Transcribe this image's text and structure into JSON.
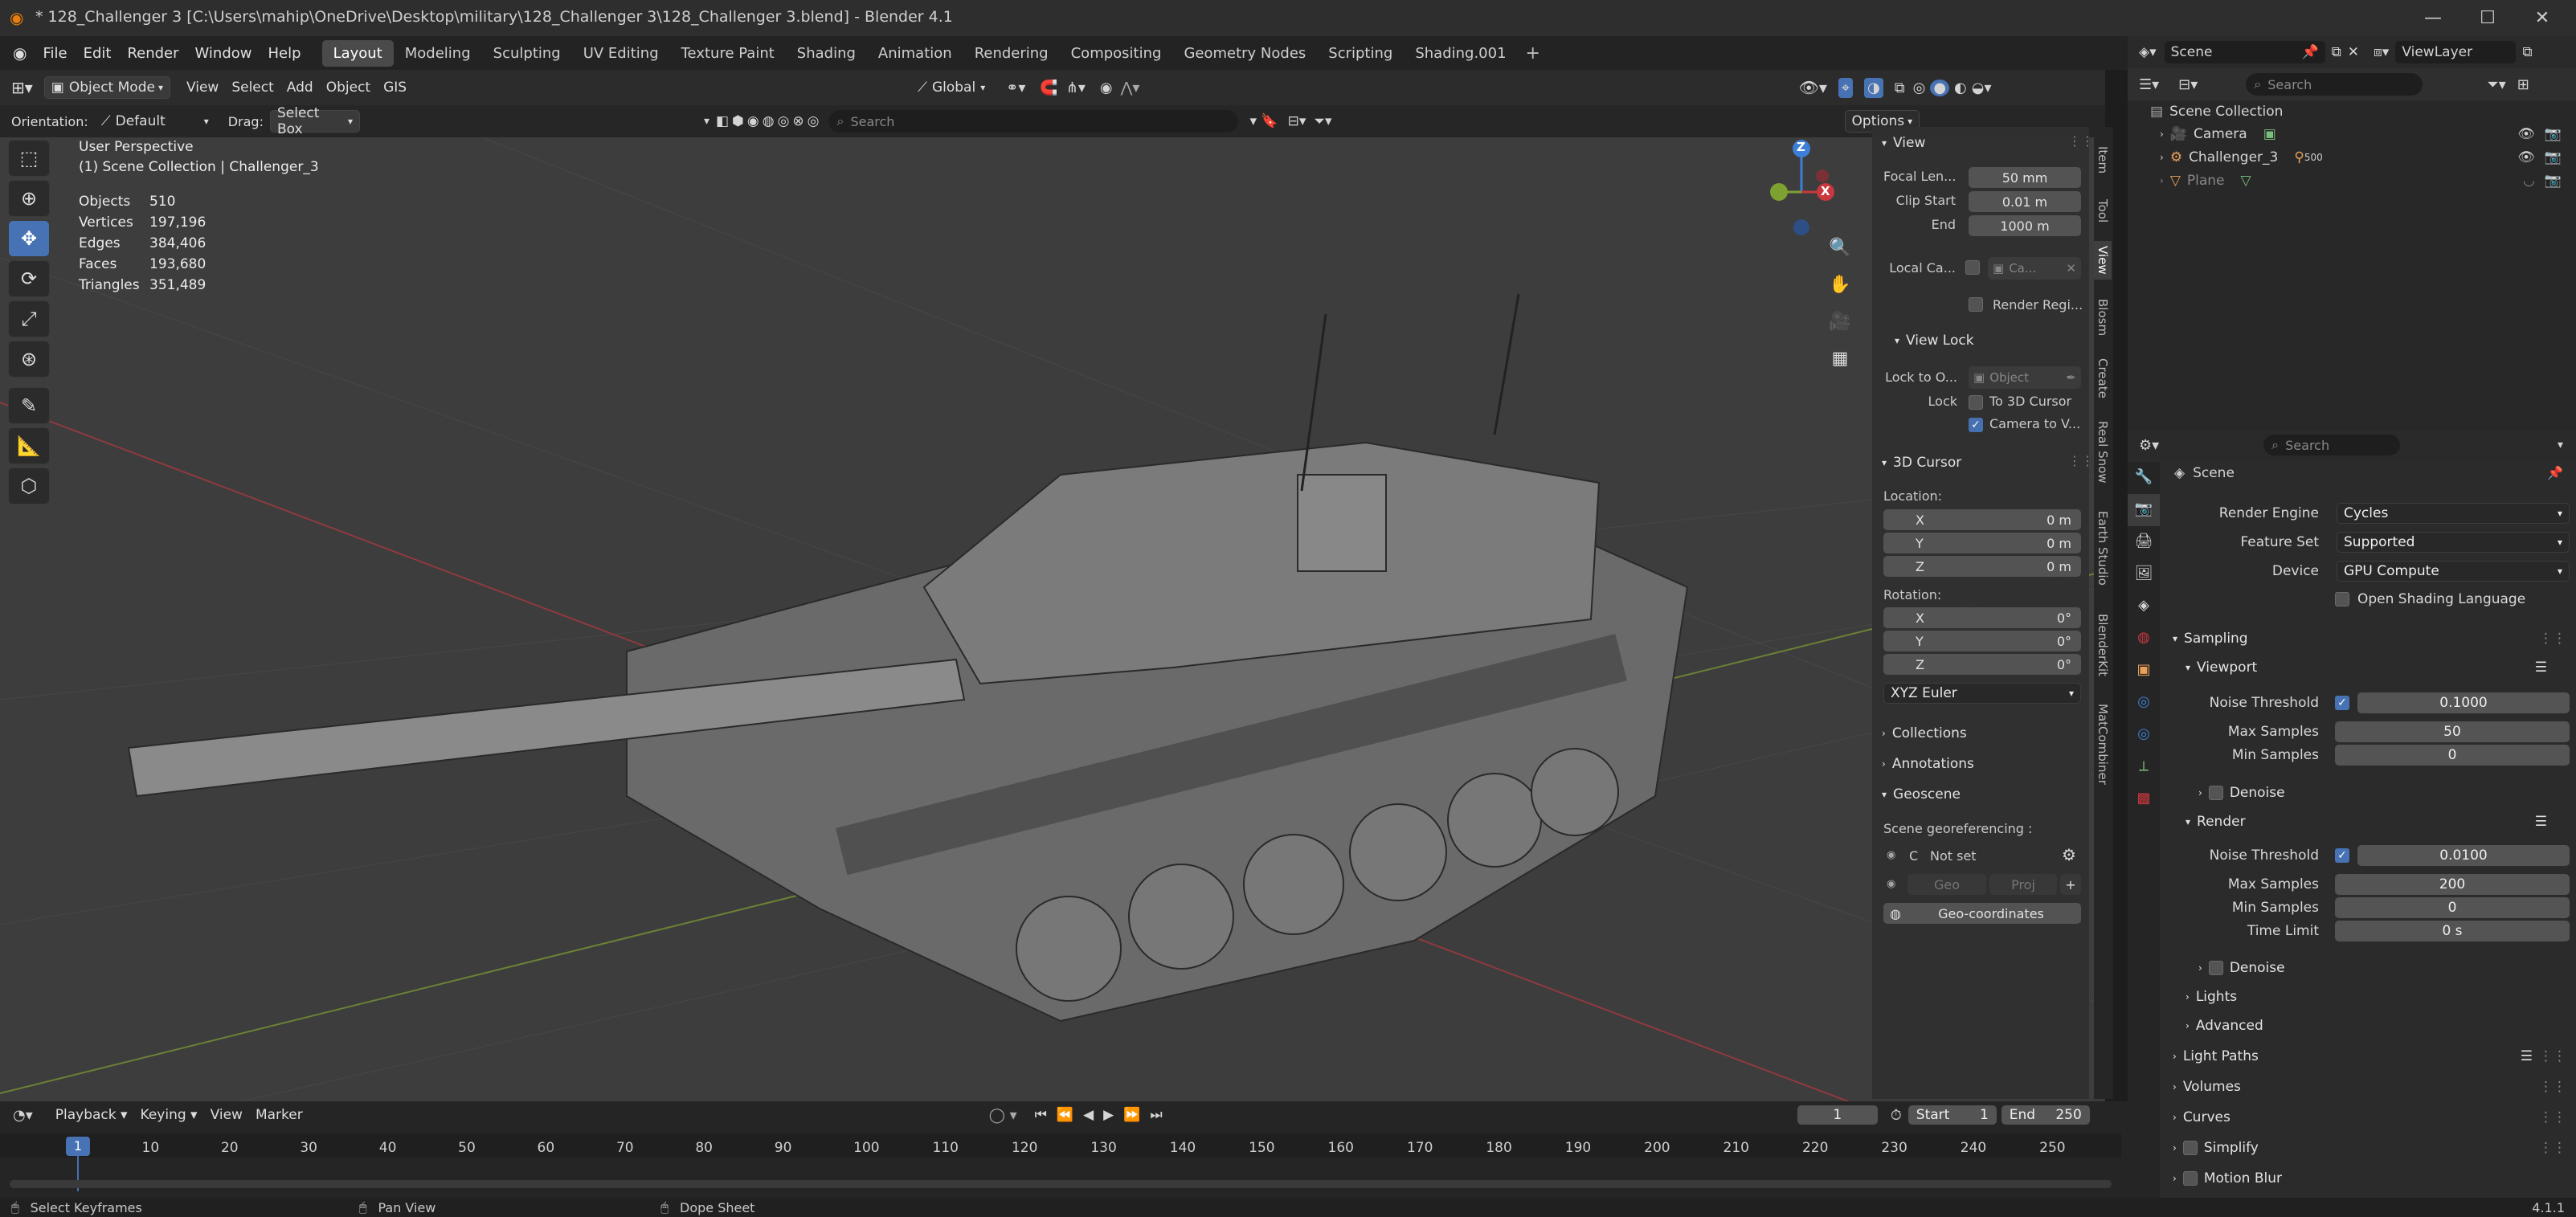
{
  "window": {
    "title": "* 128_Challenger 3 [C:\\Users\\mahip\\OneDrive\\Desktop\\military\\128_Challenger 3\\128_Challenger 3.blend] - Blender 4.1"
  },
  "menu": [
    "File",
    "Edit",
    "Render",
    "Window",
    "Help"
  ],
  "workspaces": [
    "Layout",
    "Modeling",
    "Sculpting",
    "UV Editing",
    "Texture Paint",
    "Shading",
    "Animation",
    "Rendering",
    "Compositing",
    "Geometry Nodes",
    "Scripting",
    "Shading.001"
  ],
  "scene_selector": {
    "scene": "Scene",
    "view_layer": "ViewLayer"
  },
  "header": {
    "mode": "Object Mode",
    "menus": [
      "View",
      "Select",
      "Add",
      "Object",
      "GIS"
    ],
    "transform_orientation": "Global",
    "orientation_label": "Orientation:",
    "orientation_value": "Default",
    "drag_label": "Drag:",
    "drag_value": "Select Box",
    "search_placeholder": "Search",
    "options_label": "Options"
  },
  "viewport": {
    "perspective": "User Perspective",
    "collection": "(1) Scene Collection | Challenger_3",
    "stats": [
      {
        "label": "Objects",
        "value": "510"
      },
      {
        "label": "Vertices",
        "value": "197,196"
      },
      {
        "label": "Edges",
        "value": "384,406"
      },
      {
        "label": "Faces",
        "value": "193,680"
      },
      {
        "label": "Triangles",
        "value": "351,489"
      }
    ],
    "gizmo": {
      "x": "X",
      "y": "Y",
      "z": "Z"
    }
  },
  "npanel": {
    "tabs": [
      "Item",
      "Tool",
      "View",
      "Blosm",
      "Create",
      "Real Snow",
      "Earth Studio",
      "BlenderKit",
      "MatCombiner"
    ],
    "view": {
      "title": "View",
      "focal_label": "Focal Len...",
      "focal_value": "50 mm",
      "clip_start_label": "Clip Start",
      "clip_start_value": "0.01 m",
      "end_label": "End",
      "end_value": "1000 m",
      "local_camera_label": "Local Ca...",
      "local_camera_value": "Ca...",
      "render_region_label": "Render Regi..."
    },
    "view_lock": {
      "title": "View Lock",
      "lock_to_label": "Lock to O...",
      "lock_to_value": "Object",
      "lock_label": "Lock",
      "to_cursor_label": "To 3D Cursor",
      "camera_to_view_label": "Camera to V..."
    },
    "cursor": {
      "title": "3D Cursor",
      "location_label": "Location:",
      "rotation_label": "Rotation:",
      "loc": [
        {
          "axis": "X",
          "value": "0 m"
        },
        {
          "axis": "Y",
          "value": "0 m"
        },
        {
          "axis": "Z",
          "value": "0 m"
        }
      ],
      "rot": [
        {
          "axis": "X",
          "value": "0°"
        },
        {
          "axis": "Y",
          "value": "0°"
        },
        {
          "axis": "Z",
          "value": "0°"
        }
      ],
      "rotation_mode": "XYZ Euler"
    },
    "collections_label": "Collections",
    "annotations_label": "Annotations",
    "geoscene": {
      "title": "Geoscene",
      "georef_label": "Scene georeferencing :",
      "crs_prefix": "C",
      "crs_value": "Not set",
      "geo_label": "Geo",
      "proj_label": "Proj",
      "geocoords_label": "Geo-coordinates"
    }
  },
  "outliner": {
    "search_placeholder": "Search",
    "root": "Scene Collection",
    "items": [
      {
        "name": "Camera",
        "extra": ""
      },
      {
        "name": "Challenger_3",
        "extra": "500"
      },
      {
        "name": "Plane",
        "extra": ""
      }
    ]
  },
  "properties": {
    "search_placeholder": "Search",
    "context": "Scene",
    "render_engine_label": "Render Engine",
    "render_engine": "Cycles",
    "feature_set_label": "Feature Set",
    "feature_set": "Supported",
    "device_label": "Device",
    "device": "GPU Compute",
    "osl_label": "Open Shading Language",
    "sampling_label": "Sampling",
    "viewport_label": "Viewport",
    "noise_threshold_label": "Noise Threshold",
    "viewport_noise": "0.1000",
    "max_samples_label": "Max Samples",
    "viewport_max": "50",
    "min_samples_label": "Min Samples",
    "viewport_min": "0",
    "denoise_label": "Denoise",
    "render_label": "Render",
    "render_noise": "0.0100",
    "render_max": "200",
    "render_min": "0",
    "time_limit_label": "Time Limit",
    "time_limit": "0 s",
    "lights_label": "Lights",
    "advanced_label": "Advanced",
    "light_paths_label": "Light Paths",
    "volumes_label": "Volumes",
    "curves_label": "Curves",
    "simplify_label": "Simplify",
    "motion_blur_label": "Motion Blur"
  },
  "timeline": {
    "menus": [
      "Playback",
      "Keying",
      "View",
      "Marker"
    ],
    "current_frame": "1",
    "start_label": "Start",
    "start": "1",
    "end_label": "End",
    "end": "250",
    "ticks": [
      "1",
      "10",
      "20",
      "30",
      "40",
      "50",
      "60",
      "70",
      "80",
      "90",
      "100",
      "110",
      "120",
      "130",
      "140",
      "150",
      "160",
      "170",
      "180",
      "190",
      "200",
      "210",
      "220",
      "230",
      "240",
      "250"
    ]
  },
  "status": {
    "left": "Select Keyframes",
    "middle": "Pan View",
    "right": "Dope Sheet",
    "version": "4.1.1"
  },
  "colors": {
    "accent": "#4772b3",
    "active_tab": "#4a4a4a",
    "x_axis": "#c9383e",
    "y_axis": "#7ea231",
    "z_axis": "#3d7fd6"
  }
}
